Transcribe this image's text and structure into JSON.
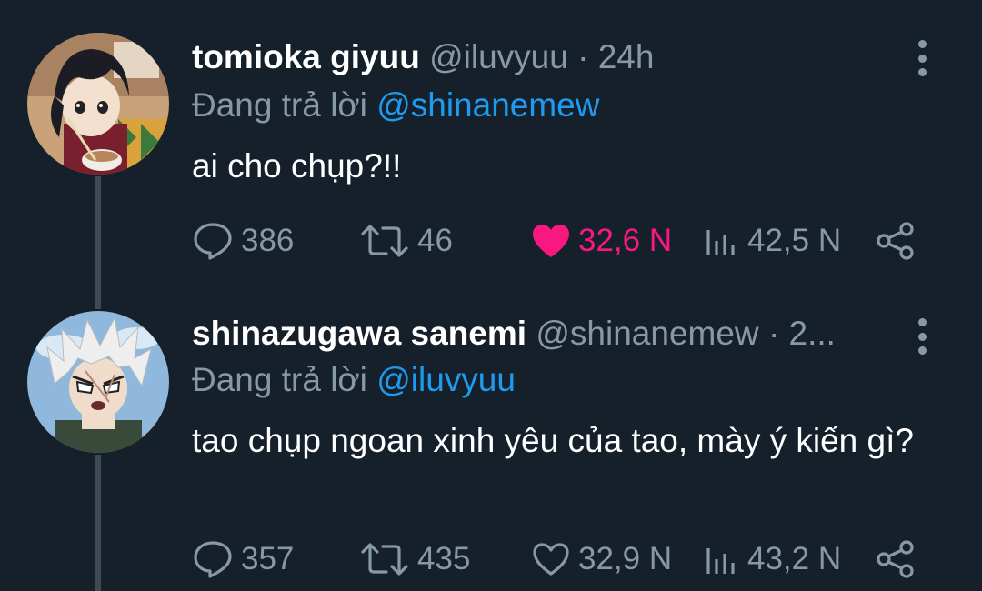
{
  "tweets": [
    {
      "display_name": "tomioka giyuu",
      "handle": "@iluvyuu",
      "separator": "·",
      "time": "24h",
      "reply_prefix": "Đang trả lời",
      "reply_to": "@shinanemew",
      "text": "ai cho chụp?!!",
      "replies": "386",
      "retweets": "46",
      "likes": "32,6 N",
      "liked": true,
      "views": "42,5 N",
      "avatar_icon": "anime-avatar-dark-hair"
    },
    {
      "display_name": "shinazugawa sanemi",
      "handle": "@shinanemew",
      "separator": "·",
      "time": "2...",
      "reply_prefix": "Đang trả lời",
      "reply_to": "@iluvyuu",
      "text": "tao chụp ngoan xinh yêu của tao, mày ý kiến gì?",
      "replies": "357",
      "retweets": "435",
      "likes": "32,9 N",
      "liked": false,
      "views": "43,2 N",
      "avatar_icon": "anime-avatar-white-hair"
    }
  ],
  "colors": {
    "background": "#15202b",
    "muted": "#8899a6",
    "mention": "#1d9bf0",
    "like_active": "#f91880"
  }
}
